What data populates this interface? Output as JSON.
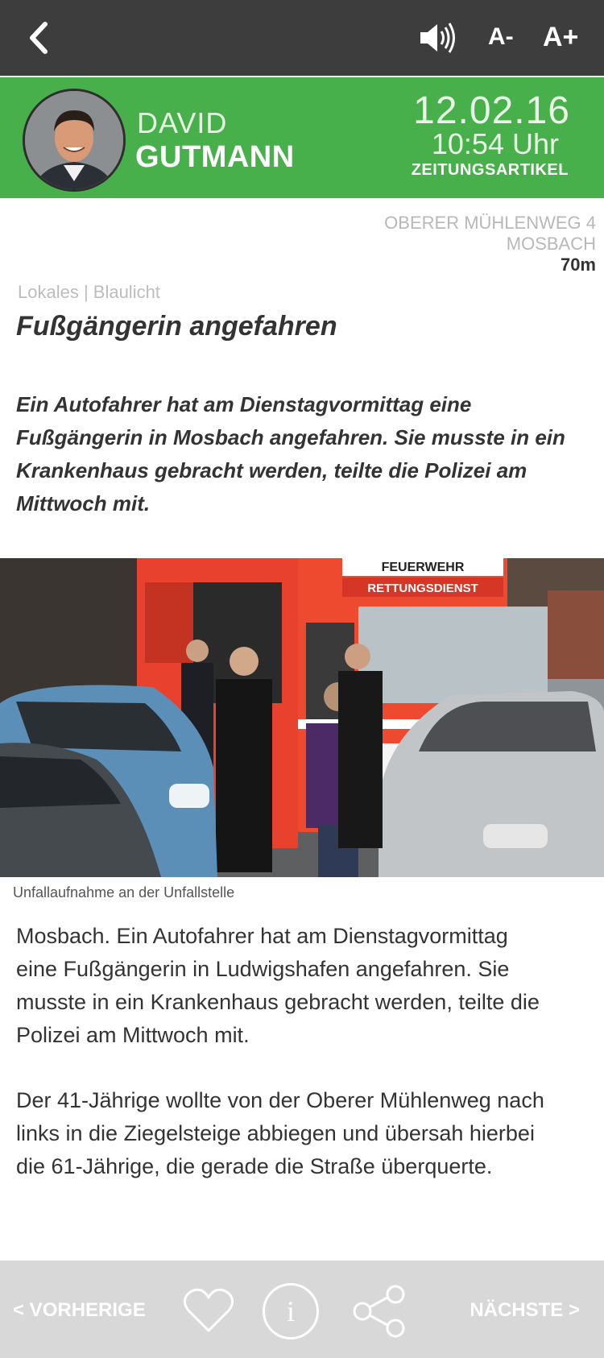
{
  "topbar": {
    "back_icon": "chevron-left-icon",
    "speaker_icon": "speaker-icon",
    "font_decrease": "A-",
    "font_increase": "A+"
  },
  "author": {
    "first_name": "DAVID",
    "last_name": "GUTMANN",
    "date": "12.02.16",
    "time": "10:54 Uhr",
    "type": "ZEITUNGSARTIKEL",
    "accent_color": "#48b04a"
  },
  "location": {
    "street": "OBERER MÜHLENWEG 4",
    "city": "MOSBACH",
    "distance": "70m"
  },
  "article": {
    "category": "Lokales | Blaulicht",
    "headline": "Fußgängerin angefahren",
    "lead_lines": [
      "Ein Autofahrer hat am Dienstagvormittag eine",
      "Fußgängerin in Mosbach angefahren. Sie musste in ein",
      "Krankenhaus gebracht werden, teilte die Polizei am",
      "Mittwoch mit."
    ],
    "photo": {
      "sign_top": "FEUERWEHR",
      "sign_bottom": "RETTUNGSDIENST",
      "caption": "Unfallaufnahme an der Unfallstelle"
    },
    "paragraph1_lines": [
      "Mosbach. Ein Autofahrer hat am Dienstagvormittag",
      "eine Fußgängerin in Ludwigshafen angefahren. Sie",
      "musste in ein Krankenhaus gebracht werden, teilte die",
      "Polizei am Mittwoch mit."
    ],
    "paragraph2_lines": [
      "Der 41-Jährige wollte von der Oberer Mühlenweg nach",
      "links in die Ziegelsteige abbiegen und übersah hierbei",
      "die 61-Jährige, die gerade die Straße überquerte."
    ]
  },
  "bottombar": {
    "prev_label": "< VORHERIGE",
    "next_label": "NÄCHSTE >",
    "info_label": "i",
    "heart_icon": "heart-icon",
    "share_icon": "share-icon"
  }
}
